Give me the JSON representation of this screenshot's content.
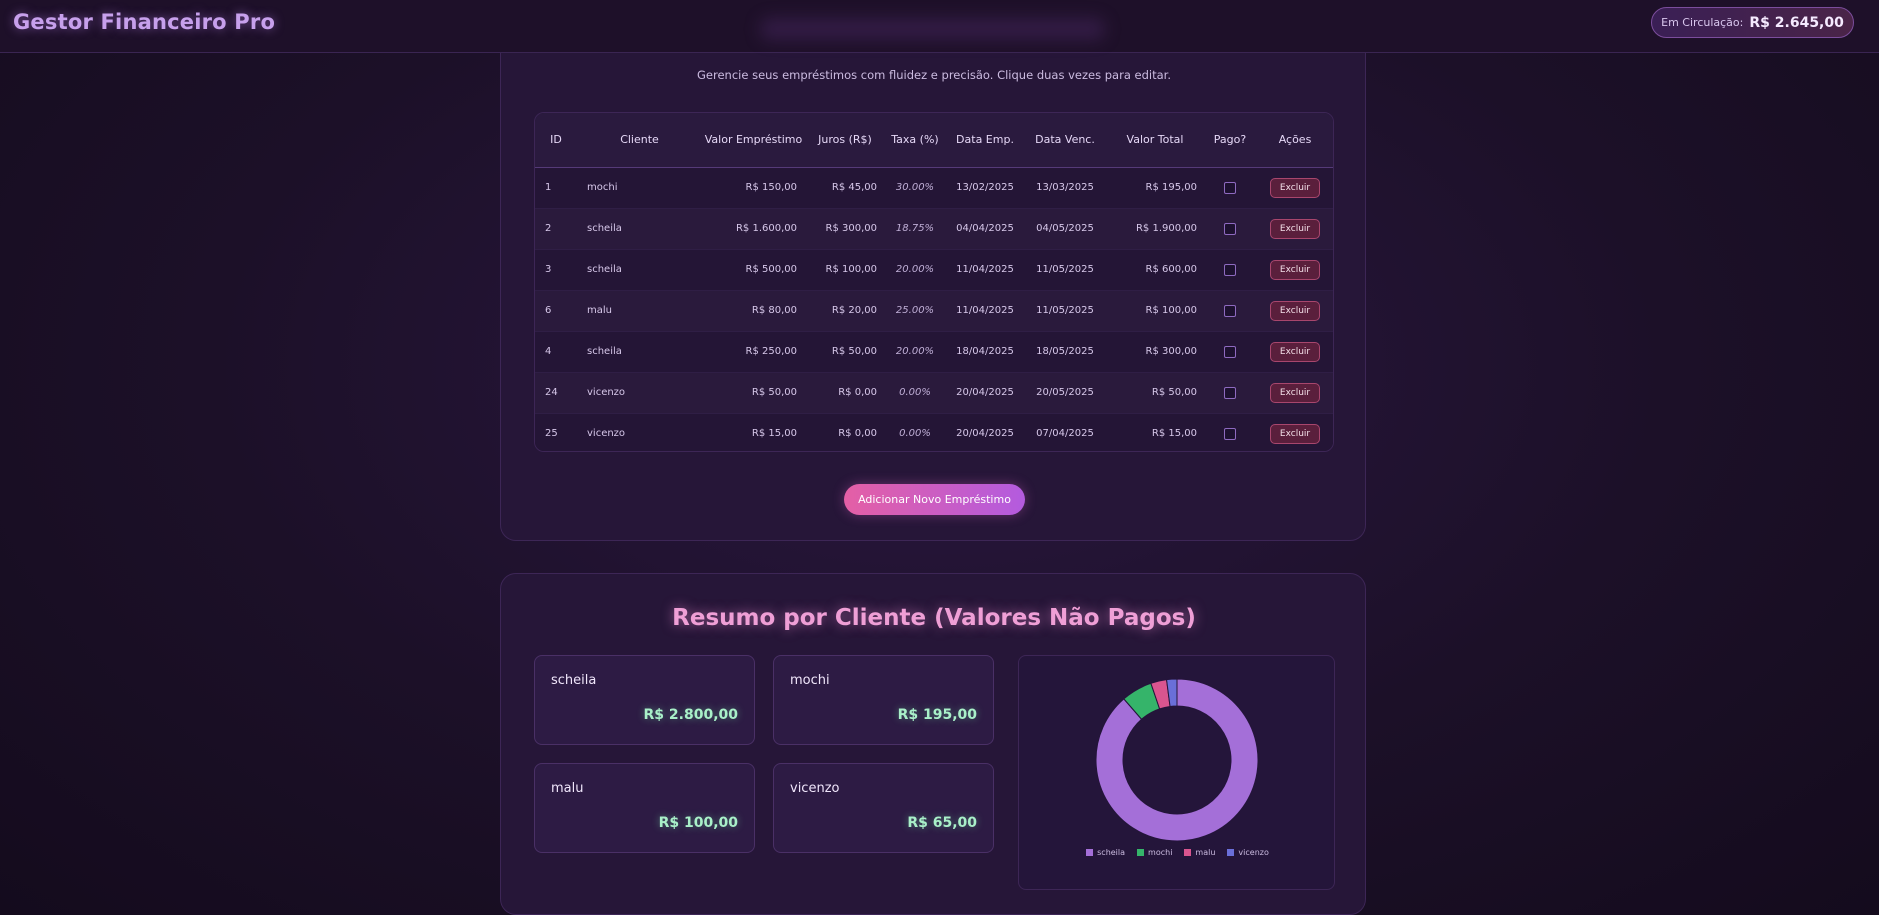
{
  "header": {
    "brand": "Gestor Financeiro Pro",
    "circulation_label": "Em Circulação:",
    "circulation_value": "R$ 2.645,00"
  },
  "loans": {
    "subtitle": "Gerencie seus empréstimos com fluidez e precisão. Clique duas vezes para editar.",
    "columns": [
      "ID",
      "Cliente",
      "Valor Empréstimo",
      "Juros (R$)",
      "Taxa (%)",
      "Data Emp.",
      "Data Venc.",
      "Valor Total",
      "Pago?",
      "Ações"
    ],
    "rows": [
      {
        "id": "1",
        "cliente": "mochi",
        "valor": "R$ 150,00",
        "juros": "R$ 45,00",
        "taxa": "30.00%",
        "data_emp": "13/02/2025",
        "data_venc": "13/03/2025",
        "total": "R$ 195,00",
        "acao": "Excluir"
      },
      {
        "id": "2",
        "cliente": "scheila",
        "valor": "R$ 1.600,00",
        "juros": "R$ 300,00",
        "taxa": "18.75%",
        "data_emp": "04/04/2025",
        "data_venc": "04/05/2025",
        "total": "R$ 1.900,00",
        "acao": "Excluir"
      },
      {
        "id": "3",
        "cliente": "scheila",
        "valor": "R$ 500,00",
        "juros": "R$ 100,00",
        "taxa": "20.00%",
        "data_emp": "11/04/2025",
        "data_venc": "11/05/2025",
        "total": "R$ 600,00",
        "acao": "Excluir"
      },
      {
        "id": "6",
        "cliente": "malu",
        "valor": "R$ 80,00",
        "juros": "R$ 20,00",
        "taxa": "25.00%",
        "data_emp": "11/04/2025",
        "data_venc": "11/05/2025",
        "total": "R$ 100,00",
        "acao": "Excluir"
      },
      {
        "id": "4",
        "cliente": "scheila",
        "valor": "R$ 250,00",
        "juros": "R$ 50,00",
        "taxa": "20.00%",
        "data_emp": "18/04/2025",
        "data_venc": "18/05/2025",
        "total": "R$ 300,00",
        "acao": "Excluir"
      },
      {
        "id": "24",
        "cliente": "vicenzo",
        "valor": "R$ 50,00",
        "juros": "R$ 0,00",
        "taxa": "0.00%",
        "data_emp": "20/04/2025",
        "data_venc": "20/05/2025",
        "total": "R$ 50,00",
        "acao": "Excluir"
      },
      {
        "id": "25",
        "cliente": "vicenzo",
        "valor": "R$ 15,00",
        "juros": "R$ 0,00",
        "taxa": "0.00%",
        "data_emp": "20/04/2025",
        "data_venc": "07/04/2025",
        "total": "R$ 15,00",
        "acao": "Excluir"
      }
    ],
    "add_button": "Adicionar Novo Empréstimo"
  },
  "summary": {
    "title": "Resumo por Cliente (Valores Não Pagos)",
    "clients": [
      {
        "name": "scheila",
        "value": "R$ 2.800,00"
      },
      {
        "name": "mochi",
        "value": "R$ 195,00"
      },
      {
        "name": "malu",
        "value": "R$ 100,00"
      },
      {
        "name": "vicenzo",
        "value": "R$ 65,00"
      }
    ]
  },
  "chart_data": {
    "type": "pie",
    "variant": "doughnut",
    "categories": [
      "scheila",
      "mochi",
      "malu",
      "vicenzo"
    ],
    "values": [
      2800,
      195,
      100,
      65
    ],
    "colors": [
      "#a46fd8",
      "#35b46a",
      "#d9558f",
      "#6a6fd9"
    ],
    "legend_position": "bottom"
  }
}
